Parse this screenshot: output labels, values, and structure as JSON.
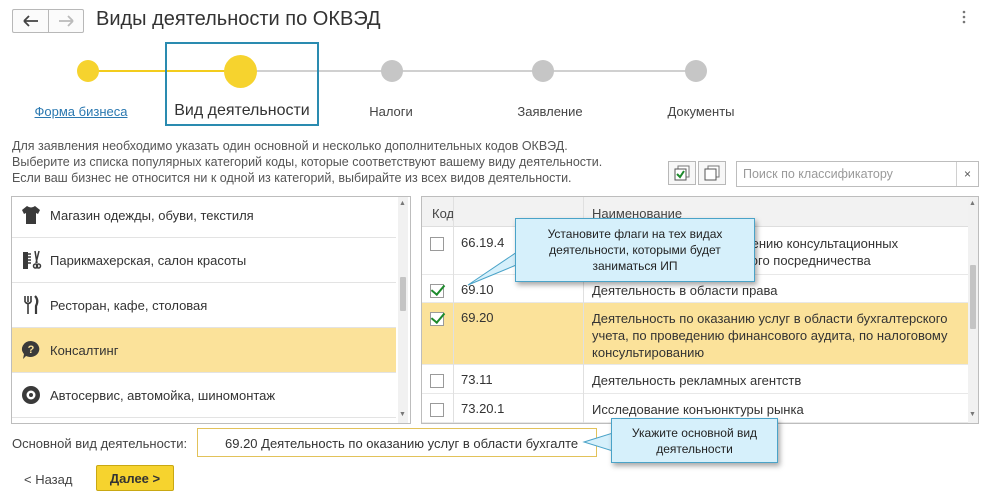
{
  "header": {
    "title": "Виды деятельности по ОКВЭД",
    "back_icon": "arrow-left-icon",
    "forward_icon": "arrow-right-icon",
    "more_icon": "more-vertical-icon"
  },
  "steps": [
    {
      "label": "Форма бизнеса",
      "state": "done"
    },
    {
      "label": "Вид деятельности",
      "state": "current"
    },
    {
      "label": "Налоги",
      "state": "todo"
    },
    {
      "label": "Заявление",
      "state": "todo"
    },
    {
      "label": "Документы",
      "state": "todo"
    }
  ],
  "description": {
    "line1": "Для заявления необходимо указать один основной и несколько дополнительных кодов ОКВЭД.",
    "line2": "Выберите из списка популярных категорий коды, которые соответствуют вашему виду деятельности.",
    "line3": "Если ваш бизнес не относится ни к одной из категорий, выбирайте из всех видов деятельности."
  },
  "search": {
    "placeholder": "Поиск по классификатору",
    "clear": "×"
  },
  "categories": [
    {
      "label": "Магазин одежды, обуви, текстиля",
      "icon": "clothes-icon"
    },
    {
      "label": "Парикмахерская, салон красоты",
      "icon": "comb-scissors-icon"
    },
    {
      "label": "Ресторан, кафе, столовая",
      "icon": "fork-knife-icon"
    },
    {
      "label": "Консалтинг",
      "icon": "question-bubble-icon",
      "selected": true
    },
    {
      "label": "Автосервис, автомойка, шиномонтаж",
      "icon": "tire-icon"
    }
  ],
  "table": {
    "headers": {
      "code": "Код",
      "name": "Наименование"
    },
    "rows": [
      {
        "code": "66.19.4",
        "name": "...лению консультационных ...вого посредничества",
        "name_line1": "лению консультационных",
        "name_line2": "вого посредничества",
        "checked": false
      },
      {
        "code": "69.10",
        "name_line1": "Деятельность в области права",
        "checked": true
      },
      {
        "code": "69.20",
        "name_line1": "Деятельность по оказанию услуг в области бухгалтерского",
        "name_line2": "учета, по проведению финансового аудита, по налоговому",
        "name_line3": "консультированию",
        "checked": true,
        "selected": true
      },
      {
        "code": "73.11",
        "name_line1": "Деятельность рекламных агентств",
        "checked": false
      },
      {
        "code": "73.20.1",
        "name_line1": "Исследование конъюнктуры рынка",
        "checked": false
      }
    ]
  },
  "main_activity": {
    "label": "Основной вид деятельности:",
    "value": "69.20 Деятельность по оказанию услуг в области бухгалте"
  },
  "buttons": {
    "back": "< Назад",
    "next": "Далее >"
  },
  "tooltips": {
    "flags_line1": "Установите флаги на тех видах",
    "flags_line2": "деятельности, которыми будет",
    "flags_line3": "заниматься ИП",
    "main_line1": "Укажите основной вид",
    "main_line2": "деятельности"
  },
  "colors": {
    "accent": "#f6d32e",
    "selection": "#fbe29a",
    "step_todo": "#c6c6c6",
    "focus": "#2a8bb0",
    "tooltip_bg": "#d6f0fb"
  }
}
